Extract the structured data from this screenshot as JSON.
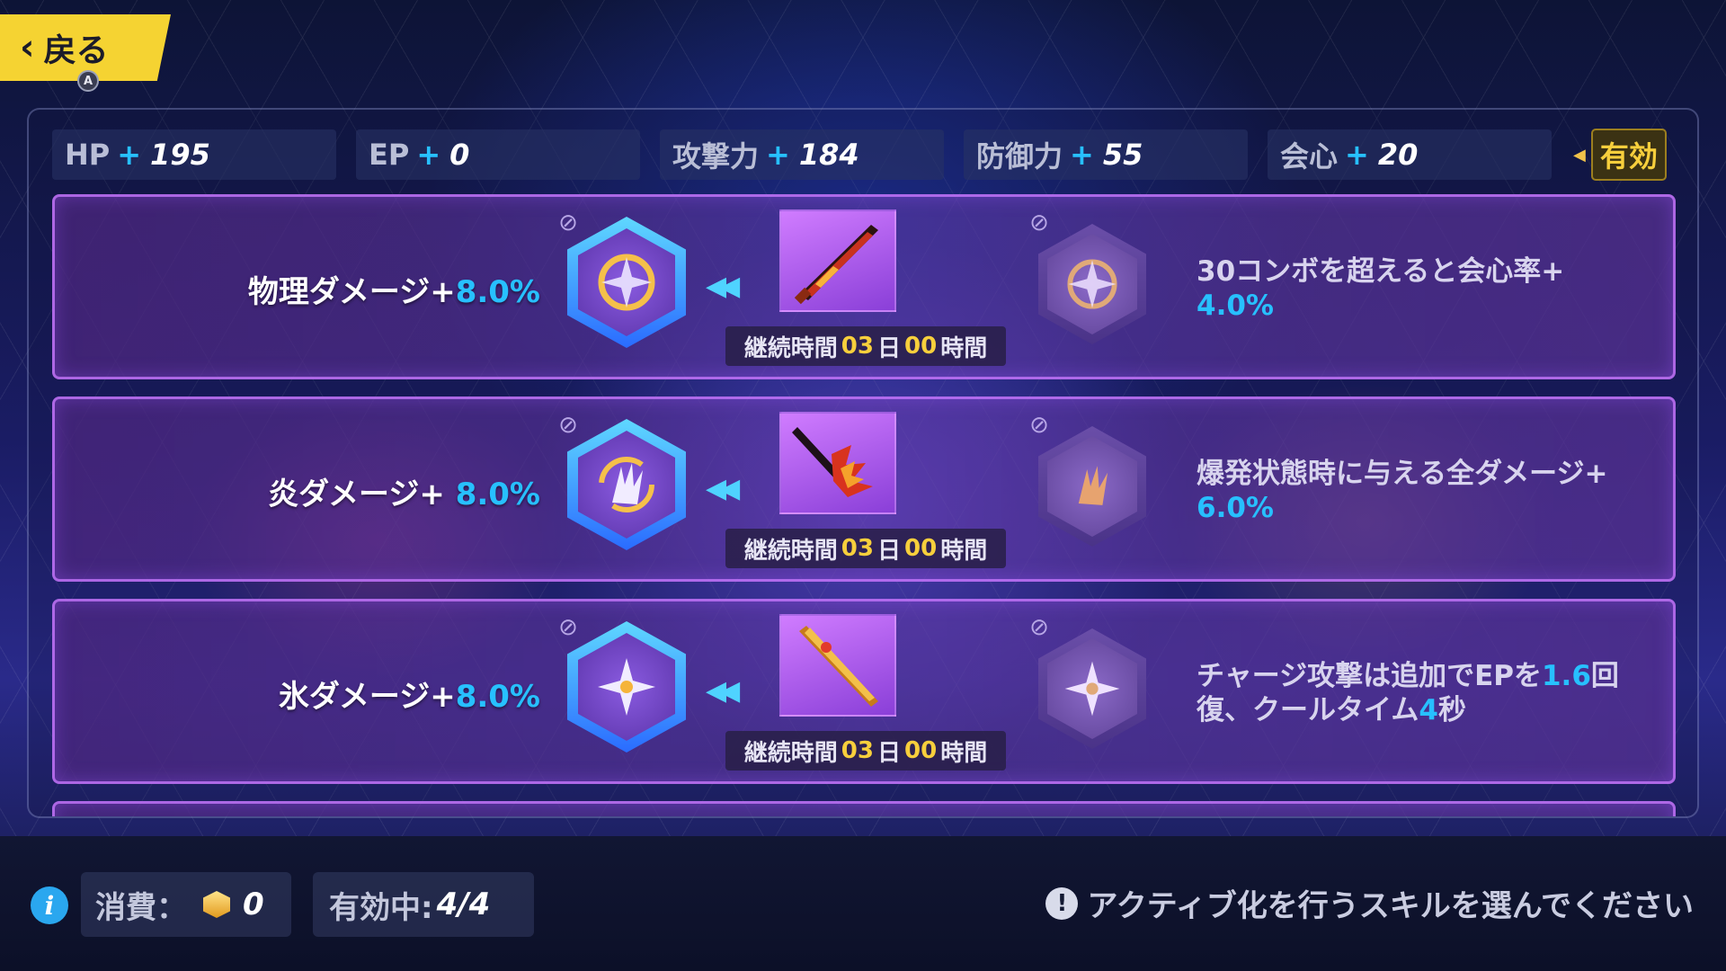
{
  "back": {
    "label": "戻る",
    "hint": "A"
  },
  "stats": [
    {
      "label": "HP",
      "plus": "+",
      "value": "195"
    },
    {
      "label": "EP",
      "plus": "+",
      "value": "0"
    },
    {
      "label": "攻撃力",
      "plus": "+",
      "value": "184"
    },
    {
      "label": "防御力",
      "plus": "+",
      "value": "55"
    },
    {
      "label": "会心",
      "plus": "+",
      "value": "20"
    }
  ],
  "active_tag": "有効",
  "rows": [
    {
      "left_label": "物理ダメージ+",
      "left_pct": "8.0%",
      "duration_prefix": "継続時間",
      "duration_days": "03",
      "duration_day_unit": "日",
      "duration_hours": "00",
      "duration_hour_unit": "時間",
      "desc_a": "30コンボを超えると会心率+",
      "desc_hl": "4.0%",
      "desc_b": ""
    },
    {
      "left_label": "炎ダメージ+ ",
      "left_pct": "8.0%",
      "duration_prefix": "継続時間",
      "duration_days": "03",
      "duration_day_unit": "日",
      "duration_hours": "00",
      "duration_hour_unit": "時間",
      "desc_a": "爆発状態時に与える全ダメージ+",
      "desc_hl": "6.0%",
      "desc_b": ""
    },
    {
      "left_label": "氷ダメージ+",
      "left_pct": "8.0%",
      "duration_prefix": "継続時間",
      "duration_days": "03",
      "duration_day_unit": "日",
      "duration_hours": "00",
      "duration_hour_unit": "時間",
      "desc_a": "チャージ攻撃は追加でEPを",
      "desc_hl": "1.6",
      "desc_b": "回復、クールタイム",
      "desc_hl2": "4",
      "desc_c": "秒"
    }
  ],
  "bottom": {
    "info_icon": "i",
    "cost_label": "消費：",
    "cost_value": "0",
    "active_label": "有効中:",
    "active_value": "4/4",
    "hint_icon": "!",
    "hint_text": "アクティブ化を行うスキルを選んでください"
  }
}
